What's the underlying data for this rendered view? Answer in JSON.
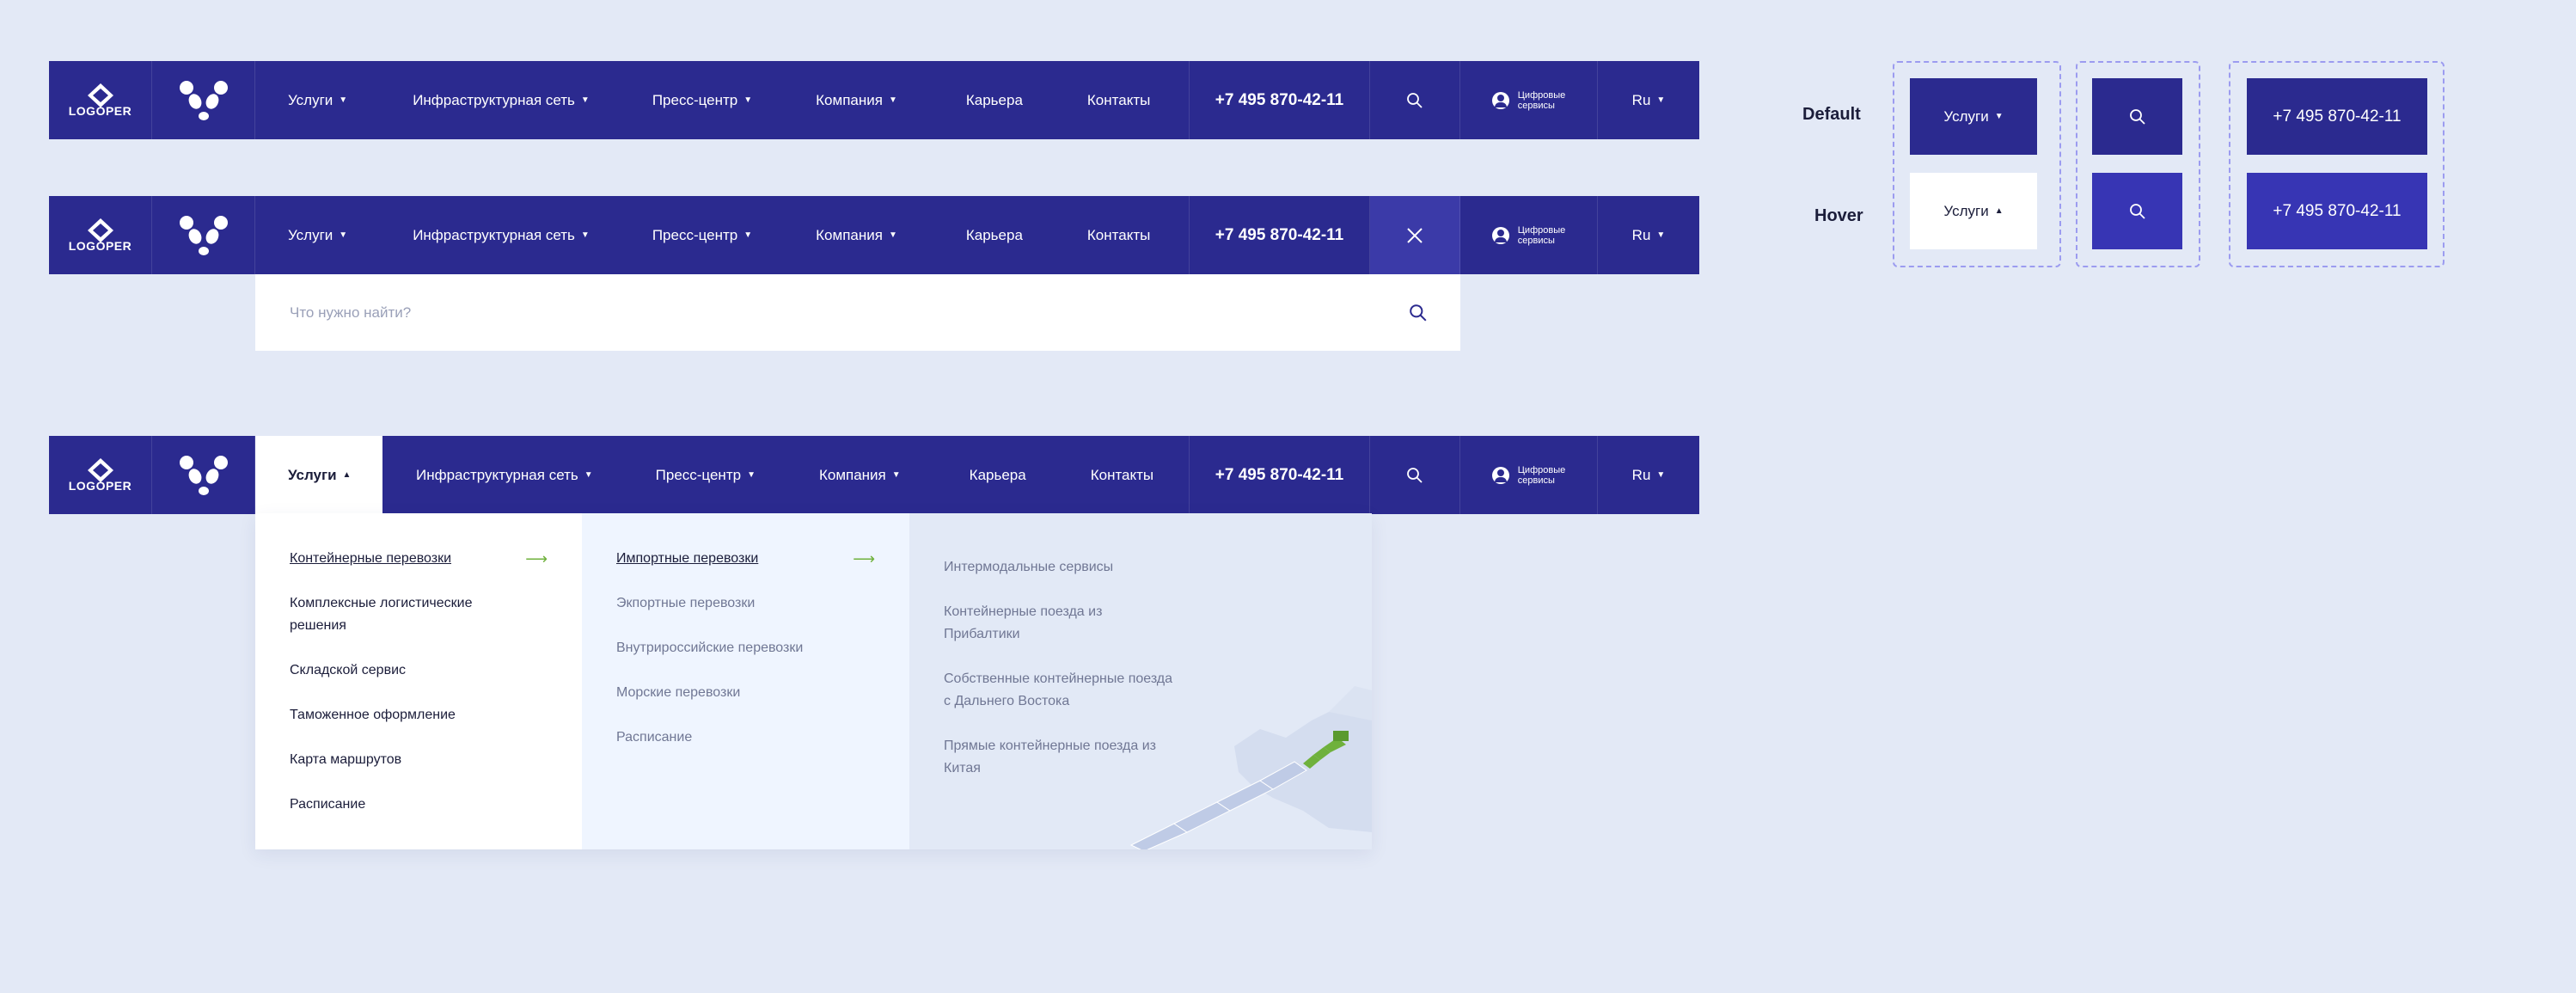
{
  "nav": {
    "logo_text": "LOGOPER",
    "menu": [
      {
        "label": "Услуги",
        "dropdown": true
      },
      {
        "label": "Инфраструктурная сеть",
        "dropdown": true
      },
      {
        "label": "Пресс-центр",
        "dropdown": true
      },
      {
        "label": "Компания",
        "dropdown": true
      },
      {
        "label": "Карьера",
        "dropdown": false
      },
      {
        "label": "Контакты",
        "dropdown": false
      }
    ],
    "phone": "+7 495 870-42-11",
    "digital_line1": "Цифровые",
    "digital_line2": "сервисы",
    "lang": "Ru"
  },
  "search": {
    "placeholder": "Что нужно найти?"
  },
  "dropdown": {
    "col1": [
      "Контейнерные перевозки",
      "Комплексные логистические решения",
      "Складской сервис",
      "Таможенное оформление",
      "Карта маршрутов",
      "Расписание"
    ],
    "col2": [
      "Импортные перевозки",
      "Экпортные перевозки",
      "Внутрироссийские перевозки",
      "Морские перевозки",
      "Расписание"
    ],
    "col3": [
      "Интермодальные сервисы",
      "Контейнерные поезда из Прибалтики",
      "Собственные контейнерные поезда с Дальнего Востока",
      "Прямые контейнерные поезда из Китая"
    ]
  },
  "states": {
    "default_label": "Default",
    "hover_label": "Hover",
    "service_label": "Услуги",
    "phone_label": "+7 495 870-42-11"
  },
  "colors": {
    "nav_bg": "#2b2a8f",
    "hover_bg": "#3735b4",
    "page_bg": "#e3e9f6",
    "accent_arrow": "#6fb13c"
  }
}
